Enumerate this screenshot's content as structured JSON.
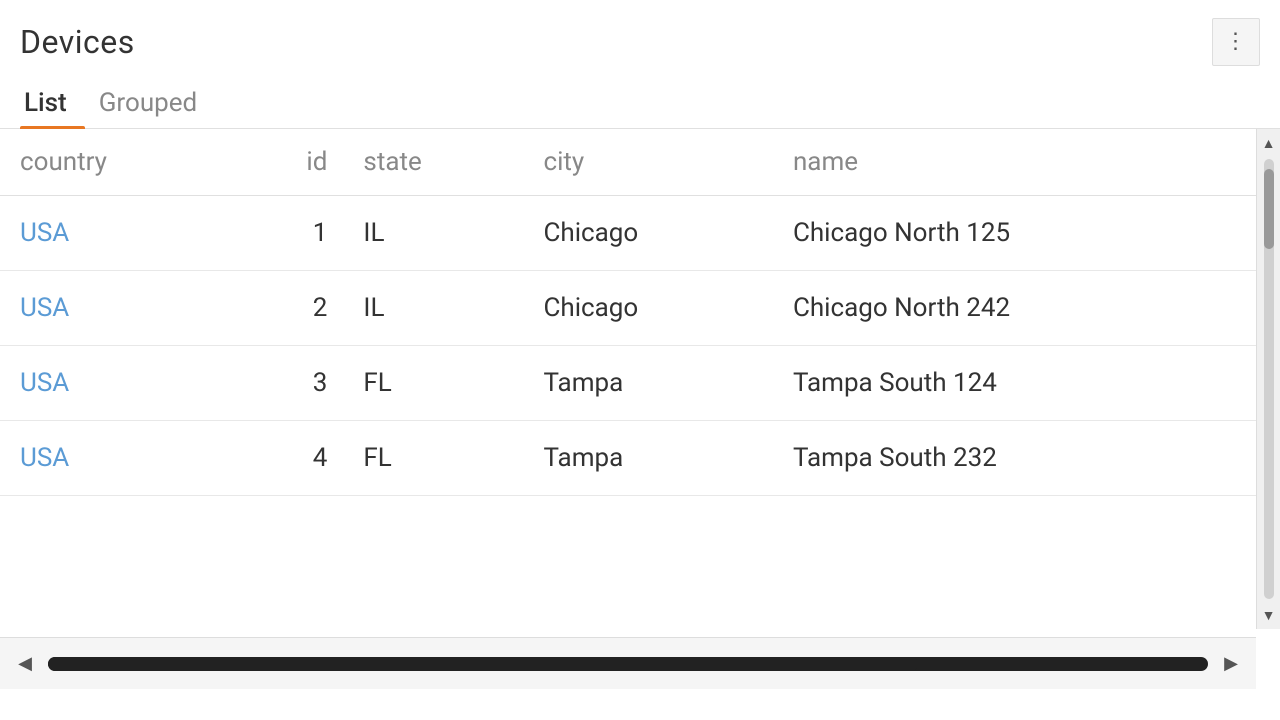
{
  "header": {
    "title": "Devices",
    "menu_label": "⋮"
  },
  "tabs": [
    {
      "id": "list",
      "label": "List",
      "active": true
    },
    {
      "id": "grouped",
      "label": "Grouped",
      "active": false
    }
  ],
  "table": {
    "columns": [
      {
        "id": "country",
        "label": "country",
        "align": "left"
      },
      {
        "id": "id",
        "label": "id",
        "align": "right"
      },
      {
        "id": "state",
        "label": "state",
        "align": "left"
      },
      {
        "id": "city",
        "label": "city",
        "align": "left"
      },
      {
        "id": "name",
        "label": "name",
        "align": "left"
      }
    ],
    "rows": [
      {
        "country": "USA",
        "id": "1",
        "state": "IL",
        "city": "Chicago",
        "name": "Chicago North 125"
      },
      {
        "country": "USA",
        "id": "2",
        "state": "IL",
        "city": "Chicago",
        "name": "Chicago North 242"
      },
      {
        "country": "USA",
        "id": "3",
        "state": "FL",
        "city": "Tampa",
        "name": "Tampa South 124"
      },
      {
        "country": "USA",
        "id": "4",
        "state": "FL",
        "city": "Tampa",
        "name": "Tampa South 232"
      }
    ]
  },
  "scrollbar": {
    "up_arrow": "▲",
    "down_arrow": "▼",
    "left_arrow": "◀",
    "right_arrow": "▶"
  }
}
